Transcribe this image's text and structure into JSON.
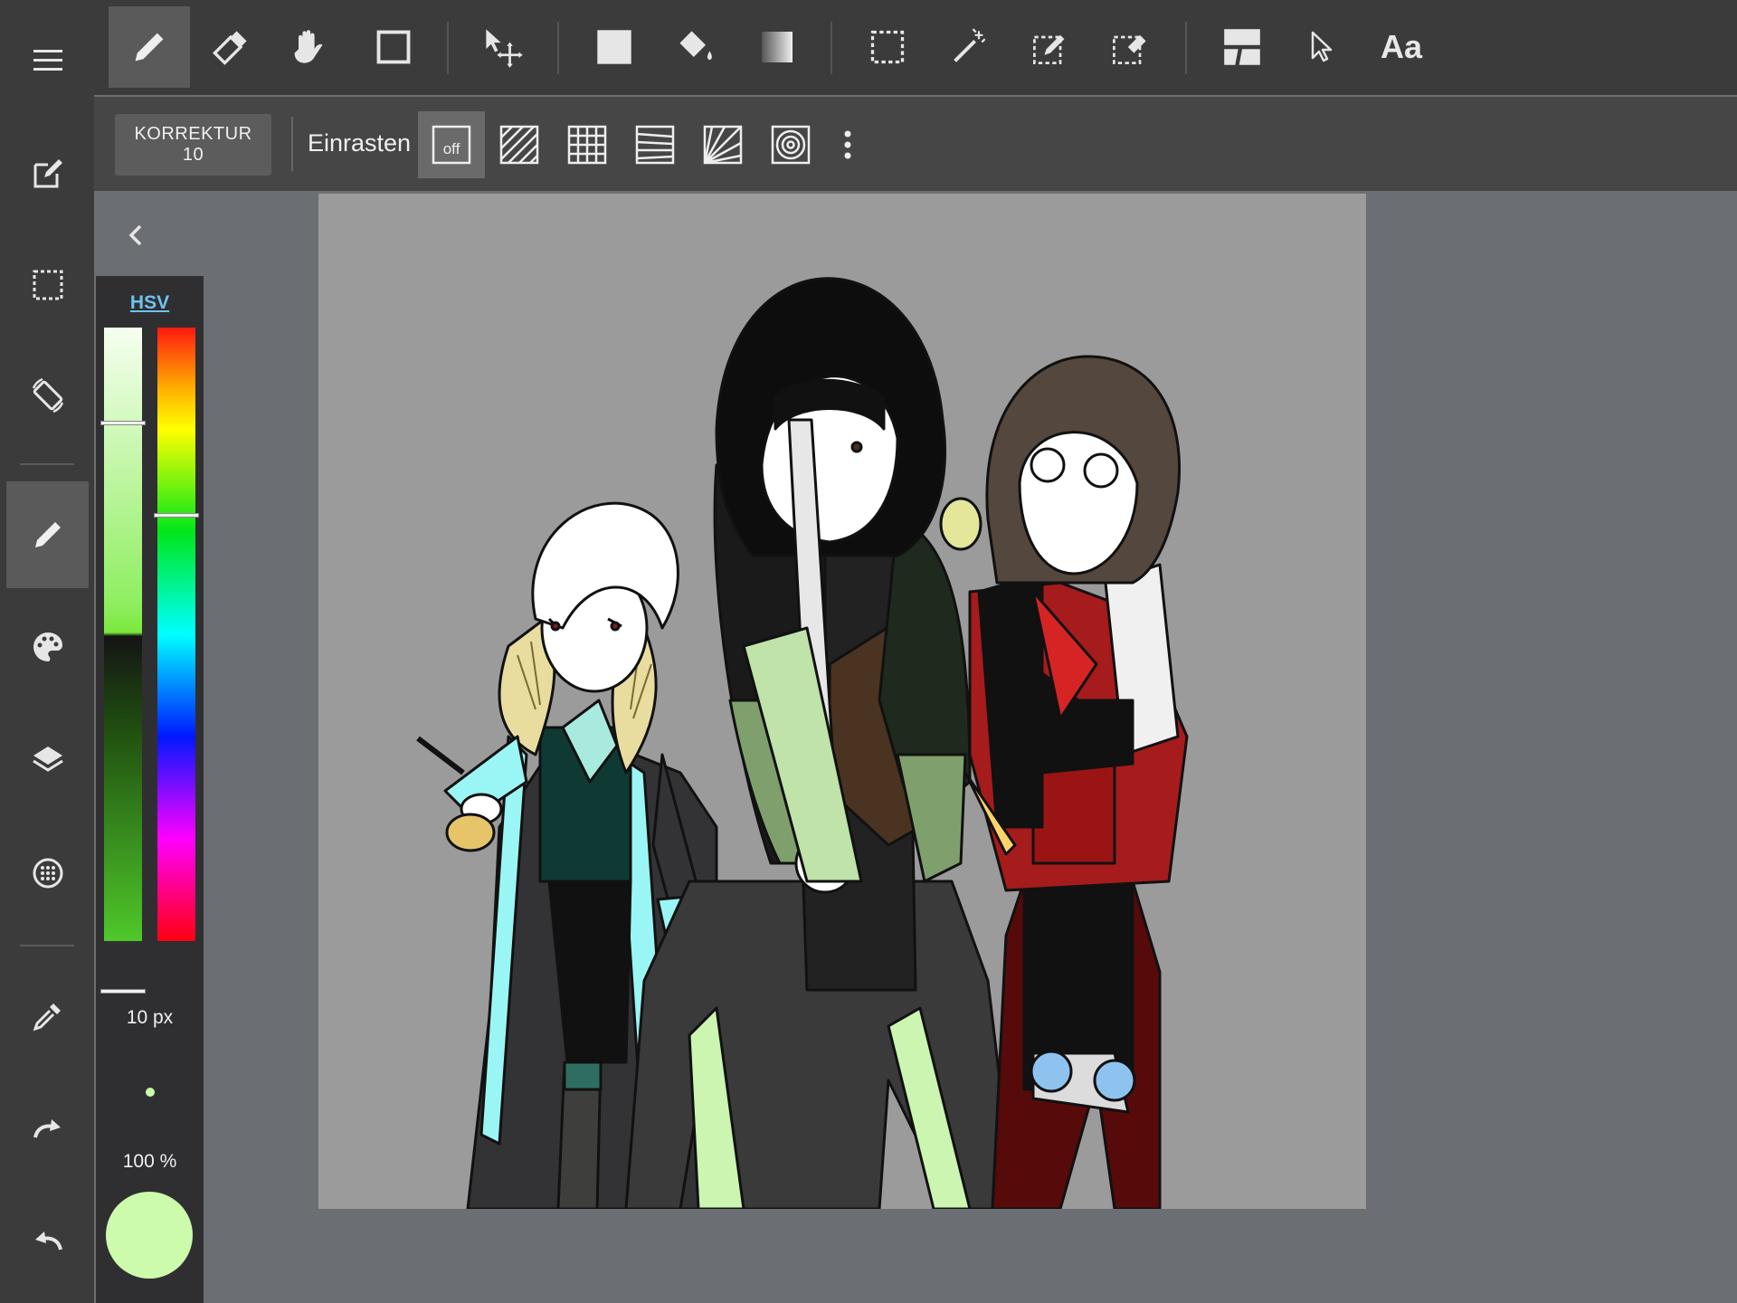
{
  "sidebar": {
    "items": [
      {
        "name": "menu-icon"
      },
      {
        "name": "edit-canvas-icon"
      },
      {
        "name": "selection-icon"
      },
      {
        "name": "rotate-icon"
      },
      {
        "name": "pen-icon"
      },
      {
        "name": "palette-icon"
      },
      {
        "name": "layers-icon"
      },
      {
        "name": "material-icon"
      },
      {
        "name": "eyedropper-icon"
      },
      {
        "name": "redo-icon"
      },
      {
        "name": "undo-icon"
      }
    ],
    "active": "pen-icon"
  },
  "toolbar": {
    "tools": [
      "pen-icon",
      "eraser-icon",
      "hand-icon",
      "rectangle-icon",
      "move-icon",
      "fill-rect-icon",
      "bucket-icon",
      "gradient-icon",
      "select-rect-icon",
      "magic-wand-icon",
      "select-pen-icon",
      "select-eraser-icon",
      "frame-divider-icon",
      "pointer-icon",
      "text-icon"
    ],
    "active": "pen-icon",
    "font_label": "Aa"
  },
  "subbar": {
    "correction_label": "KORREKTUR",
    "correction_value": "10",
    "snap_label": "Einrasten",
    "snap_off_label": "off",
    "snap_modes": [
      "off",
      "parallel",
      "grid",
      "perspective",
      "radial",
      "circle"
    ],
    "active_snap": "off"
  },
  "color_panel": {
    "mode_label": "HSV",
    "brush_size": "10 px",
    "opacity": "100 %",
    "current_color": "#cbfbab"
  },
  "colors": {
    "bg": "#6b6e73",
    "sidebar": "#3b3b3b",
    "canvas": "#9b9b9b",
    "accent": "#6fc3f0"
  }
}
